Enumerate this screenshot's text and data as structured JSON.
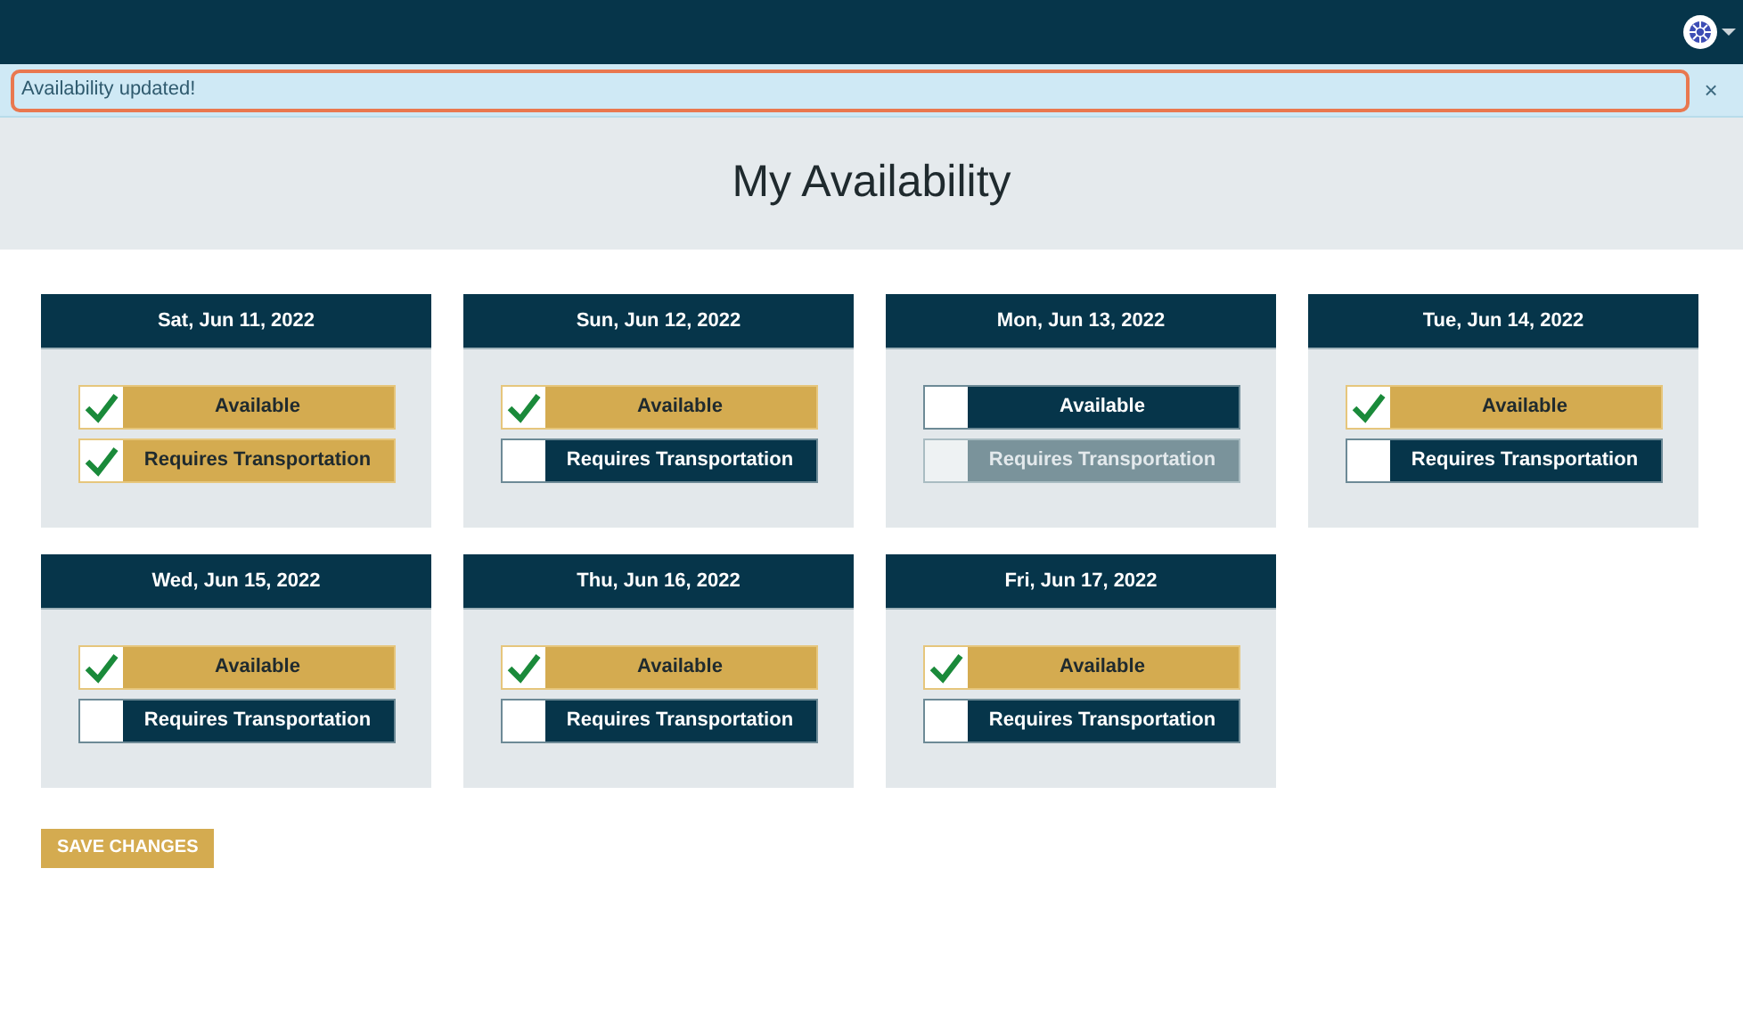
{
  "alert": {
    "message": "Availability updated!",
    "close": "×"
  },
  "page_title": "My Availability",
  "days": [
    {
      "date": "Sat, Jun 11, 2022",
      "options": [
        {
          "label": "Available",
          "checked": true,
          "disabled": false
        },
        {
          "label": "Requires Transportation",
          "checked": true,
          "disabled": false
        }
      ]
    },
    {
      "date": "Sun, Jun 12, 2022",
      "options": [
        {
          "label": "Available",
          "checked": true,
          "disabled": false
        },
        {
          "label": "Requires Transportation",
          "checked": false,
          "disabled": false
        }
      ]
    },
    {
      "date": "Mon, Jun 13, 2022",
      "options": [
        {
          "label": "Available",
          "checked": false,
          "disabled": false
        },
        {
          "label": "Requires Transportation",
          "checked": false,
          "disabled": true
        }
      ]
    },
    {
      "date": "Tue, Jun 14, 2022",
      "options": [
        {
          "label": "Available",
          "checked": true,
          "disabled": false
        },
        {
          "label": "Requires Transportation",
          "checked": false,
          "disabled": false
        }
      ]
    },
    {
      "date": "Wed, Jun 15, 2022",
      "options": [
        {
          "label": "Available",
          "checked": true,
          "disabled": false
        },
        {
          "label": "Requires Transportation",
          "checked": false,
          "disabled": false
        }
      ]
    },
    {
      "date": "Thu, Jun 16, 2022",
      "options": [
        {
          "label": "Available",
          "checked": true,
          "disabled": false
        },
        {
          "label": "Requires Transportation",
          "checked": false,
          "disabled": false
        }
      ]
    },
    {
      "date": "Fri, Jun 17, 2022",
      "options": [
        {
          "label": "Available",
          "checked": true,
          "disabled": false
        },
        {
          "label": "Requires Transportation",
          "checked": false,
          "disabled": false
        }
      ]
    }
  ],
  "save_button": "SAVE CHANGES"
}
